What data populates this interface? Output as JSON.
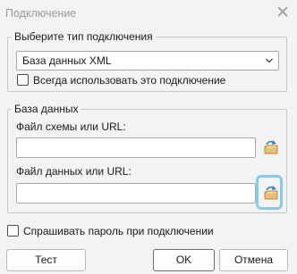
{
  "window": {
    "title": "Подключение",
    "close_glyph": "✕"
  },
  "connection_type": {
    "legend": "Выберите тип подключения",
    "selected": "База данных XML",
    "always_use_label": "Всегда использовать это подключение"
  },
  "database": {
    "legend": "База данных",
    "schema_label": "Файл схемы или URL:",
    "schema_value": "",
    "data_label": "Файл данных или URL:",
    "data_value": ""
  },
  "ask_password_label": "Спрашивать пароль при подключении",
  "buttons": {
    "test": "Тест",
    "ok": "OK",
    "cancel": "Отмена"
  },
  "icons": {
    "browse": "open-folder-icon",
    "dropdown": "chevron-down-icon"
  },
  "colors": {
    "highlight": "#86cbe8"
  }
}
